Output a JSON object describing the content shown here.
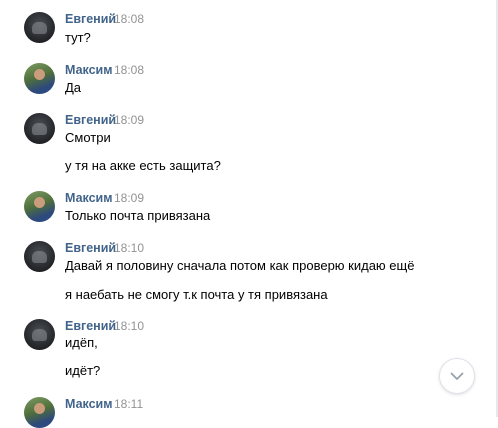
{
  "messages": [
    {
      "author": "Евгений",
      "time": "18:08",
      "lines": [
        "тут?"
      ]
    },
    {
      "author": "Максим",
      "time": "18:08",
      "lines": [
        "Да"
      ]
    },
    {
      "author": "Евгений",
      "time": "18:09",
      "lines": [
        "Смотри",
        "у тя на акке есть защита?"
      ]
    },
    {
      "author": "Максим",
      "time": "18:09",
      "lines": [
        "Только почта привязана"
      ]
    },
    {
      "author": "Евгений",
      "time": "18:10",
      "lines": [
        "Давай я половину сначала потом как проверю кидаю ещё",
        "я наебать не смогу т.к почта у тя привязана"
      ]
    },
    {
      "author": "Евгений",
      "time": "18:10",
      "lines": [
        "идёп,",
        "идёт?"
      ]
    },
    {
      "author": "Максим",
      "time": "18:11",
      "lines": []
    }
  ],
  "colors": {
    "author": "#42648b",
    "time": "#939393",
    "text": "#000000"
  },
  "icons": {
    "scroll_down": "chevron-down-icon"
  }
}
